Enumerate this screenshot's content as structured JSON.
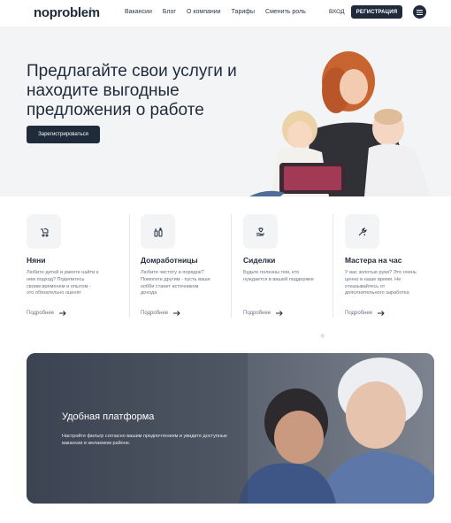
{
  "header": {
    "logo": "noproblem",
    "logo_mark": "®",
    "nav": [
      "Вакансии",
      "Блог",
      "О компании",
      "Тарифы",
      "Сменить роль"
    ],
    "login": "ВХОД",
    "register": "РЕГИСТРАЦИЯ",
    "menu_icon": "hamburger-icon"
  },
  "hero": {
    "title": "Предлагайте свои услуги и находите выгодные предложения о работе",
    "button": "Зарегистрироваться"
  },
  "cards": [
    {
      "icon": "stroller-icon",
      "title": "Няни",
      "desc": "Любите детей и умеете найти к ним подход? Поделитесь своим временем и опытом - это обязательно оценят",
      "more": "Подробнее"
    },
    {
      "icon": "cleaning-bottles-icon",
      "title": "Домработницы",
      "desc": "Любите чистоту и порядок? Помогите другим - пусть ваше хобби станет источником дохода",
      "more": "Подробнее"
    },
    {
      "icon": "heart-hand-icon",
      "title": "Сиделки",
      "desc": "Будьте полезны тем, кто нуждается в вашей поддержке",
      "more": "Подробнее"
    },
    {
      "icon": "repair-tools-icon",
      "title": "Мастера на час",
      "desc": "У вас золотые руки? Это очень ценно в наше время. Не отказывайтесь от дополнительного заработка",
      "more": "Подробнее"
    }
  ],
  "banner": {
    "title": "Удобная платформа",
    "desc": "Настройте фильтр согласно вашим предпочтениям и увидите доступные вакансии в желаемом районе."
  },
  "colors": {
    "primary": "#1f2a3a",
    "hero_bg": "#f3f4f6",
    "muted_text": "#6b7380"
  }
}
